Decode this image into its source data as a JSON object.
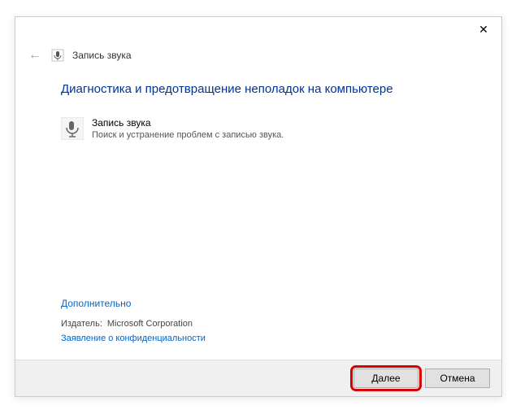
{
  "header": {
    "wizard_title": "Запись звука"
  },
  "main": {
    "heading": "Диагностика и предотвращение неполадок на компьютере",
    "item_title": "Запись звука",
    "item_desc": "Поиск и устранение проблем с записью звука."
  },
  "links": {
    "advanced": "Дополнительно",
    "publisher_label": "Издатель:",
    "publisher_value": "Microsoft Corporation",
    "privacy": "Заявление о конфиденциальности"
  },
  "footer": {
    "next": "Далее",
    "cancel": "Отмена"
  }
}
